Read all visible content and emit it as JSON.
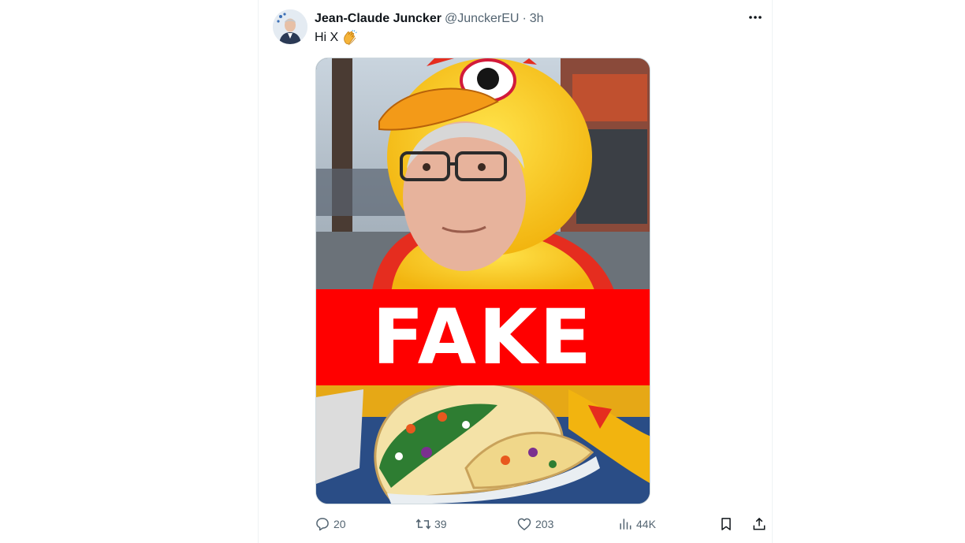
{
  "tweet": {
    "display_name": "Jean-Claude Juncker",
    "handle": "@JunckerEU",
    "separator": "·",
    "time": "3h",
    "text": "Hi X",
    "emoji": "clapping-hands",
    "media": {
      "overlay_text": "FAKE",
      "overlay_color": "#ff0000"
    },
    "actions": {
      "replies": "20",
      "reposts": "39",
      "likes": "203",
      "views": "44K"
    }
  },
  "icons": {
    "more": "more-icon",
    "reply": "reply-icon",
    "repost": "repost-icon",
    "like": "heart-icon",
    "views": "views-icon",
    "bookmark": "bookmark-icon",
    "share": "share-icon"
  },
  "colors": {
    "text_primary": "#0f1419",
    "text_secondary": "#536471",
    "fake_banner": "#ff0000",
    "border": "#eff3f4"
  }
}
